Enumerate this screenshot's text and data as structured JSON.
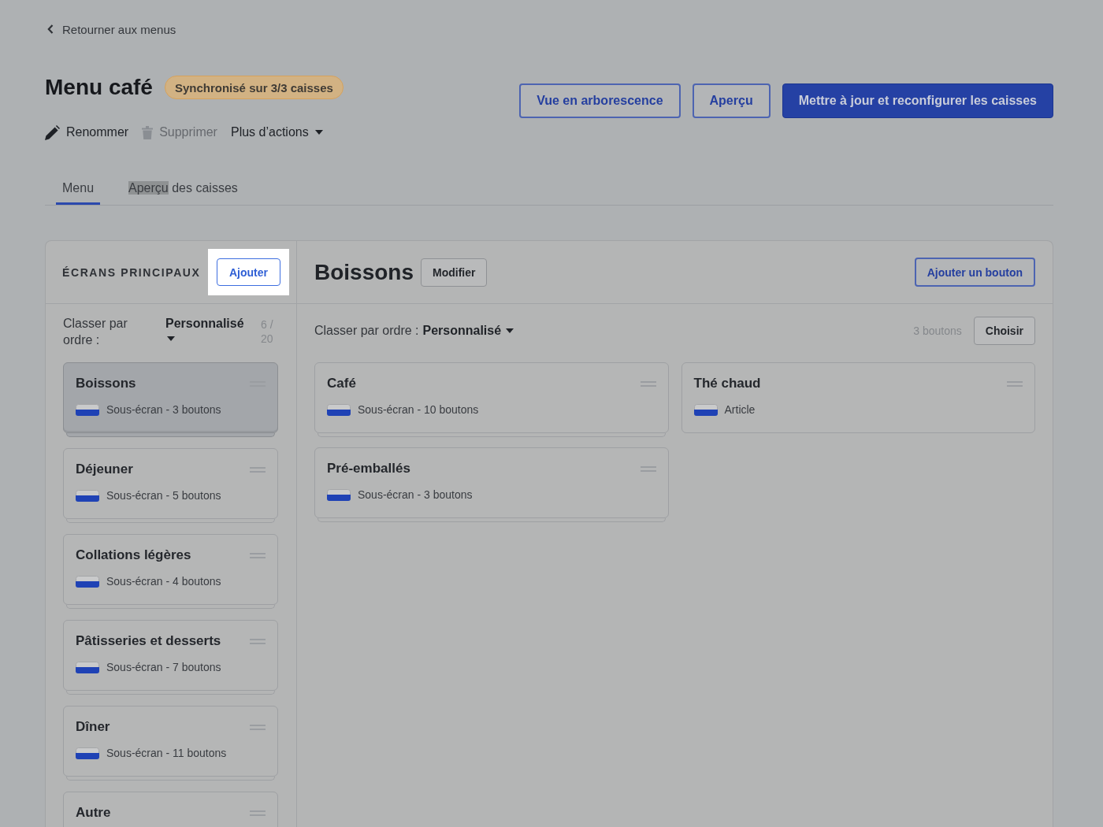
{
  "back_link": "Retourner aux menus",
  "title": "Menu café",
  "sync_badge": "Synchronisé sur 3/3 caisses",
  "header_buttons": [
    {
      "label": "Vue en arborescence",
      "kind": "outline"
    },
    {
      "label": "Aperçu",
      "kind": "outline"
    },
    {
      "label": "Mettre à jour et reconfigurer les caisses",
      "kind": "primary"
    }
  ],
  "actions": [
    {
      "label": "Renommer",
      "kind": "rename",
      "disabled": false
    },
    {
      "label": "Supprimer",
      "kind": "delete",
      "disabled": true
    },
    {
      "label": "Plus d’actions",
      "kind": "more",
      "disabled": false
    }
  ],
  "tabs": [
    {
      "label_parts": [
        {
          "text": "Menu",
          "highlighted": false
        }
      ],
      "selected": true
    },
    {
      "label_parts": [
        {
          "text": "Aperçu",
          "highlighted": true
        },
        {
          "text": " des caisses",
          "highlighted": false
        }
      ],
      "selected": false
    }
  ],
  "screens_panel": {
    "heading": "ÉCRANS PRINCIPAUX",
    "add_button": {
      "label": "Ajouter",
      "spotlight": true
    },
    "sort_label": "Classer par ordre :",
    "sort_value": "Personnalisé",
    "count": "6 / 20",
    "screens": [
      {
        "name": "Boissons",
        "subtitle": "Sous-écran - 3 boutons",
        "selected": true
      },
      {
        "name": "Déjeuner",
        "subtitle": "Sous-écran - 5 boutons",
        "selected": false
      },
      {
        "name": "Collations légères",
        "subtitle": "Sous-écran - 4 boutons",
        "selected": false
      },
      {
        "name": "Pâtisseries et desserts",
        "subtitle": "Sous-écran - 7 boutons",
        "selected": false
      },
      {
        "name": "Dîner",
        "subtitle": "Sous-écran - 11 boutons",
        "selected": false
      },
      {
        "name": "Autre",
        "selected": false
      }
    ]
  },
  "detail": {
    "title": "Boissons",
    "edit_button": "Modifier",
    "add_button": "Ajouter un bouton",
    "sort_label": "Classer par ordre :",
    "sort_value": "Personnalisé",
    "count": "3 boutons",
    "choose_button": "Choisir",
    "buttons": [
      {
        "name": "Café",
        "subtitle": "Sous-écran - 10 boutons",
        "kind": "subscreen"
      },
      {
        "name": "Thé chaud",
        "subtitle": "Article",
        "kind": "item"
      },
      {
        "name": "Pré-emballés",
        "subtitle": "Sous-écran - 3 boutons",
        "kind": "subscreen"
      }
    ]
  }
}
